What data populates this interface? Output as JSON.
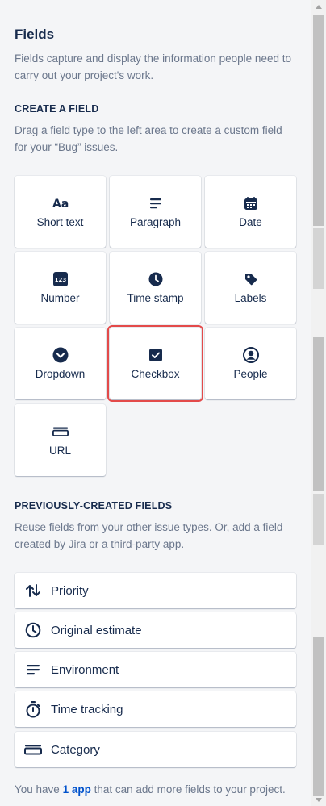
{
  "header": {
    "title": "Fields",
    "description": "Fields capture and display the information people need to carry out your project's work."
  },
  "create": {
    "heading": "CREATE A FIELD",
    "description": "Drag a field type to the left area to create a custom field for your “Bug” issues.",
    "tiles": [
      {
        "label": "Short text",
        "icon": "short-text-icon"
      },
      {
        "label": "Paragraph",
        "icon": "paragraph-icon"
      },
      {
        "label": "Date",
        "icon": "calendar-icon"
      },
      {
        "label": "Number",
        "icon": "number-icon"
      },
      {
        "label": "Time stamp",
        "icon": "clock-icon"
      },
      {
        "label": "Labels",
        "icon": "tag-icon"
      },
      {
        "label": "Dropdown",
        "icon": "chevron-circle-icon"
      },
      {
        "label": "Checkbox",
        "icon": "checkbox-icon",
        "highlighted": true
      },
      {
        "label": "People",
        "icon": "person-icon"
      },
      {
        "label": "URL",
        "icon": "link-field-icon"
      }
    ]
  },
  "previous": {
    "heading": "PREVIOUSLY-CREATED FIELDS",
    "description": "Reuse fields from your other issue types. Or, add a field created by Jira or a third-party app.",
    "items": [
      {
        "label": "Priority",
        "icon": "priority-arrows-icon"
      },
      {
        "label": "Original estimate",
        "icon": "clock-outline-icon"
      },
      {
        "label": "Environment",
        "icon": "lines-icon"
      },
      {
        "label": "Time tracking",
        "icon": "stopwatch-icon"
      },
      {
        "label": "Category",
        "icon": "category-icon"
      }
    ]
  },
  "footer": {
    "prefix": "You have ",
    "link": "1 app",
    "suffix": " that can add more fields to your project."
  },
  "colors": {
    "background": "#f4f5f7",
    "text": "#172b4d",
    "subtle": "#6b778c",
    "link": "#0052cc",
    "highlight": "#e34a4a"
  }
}
